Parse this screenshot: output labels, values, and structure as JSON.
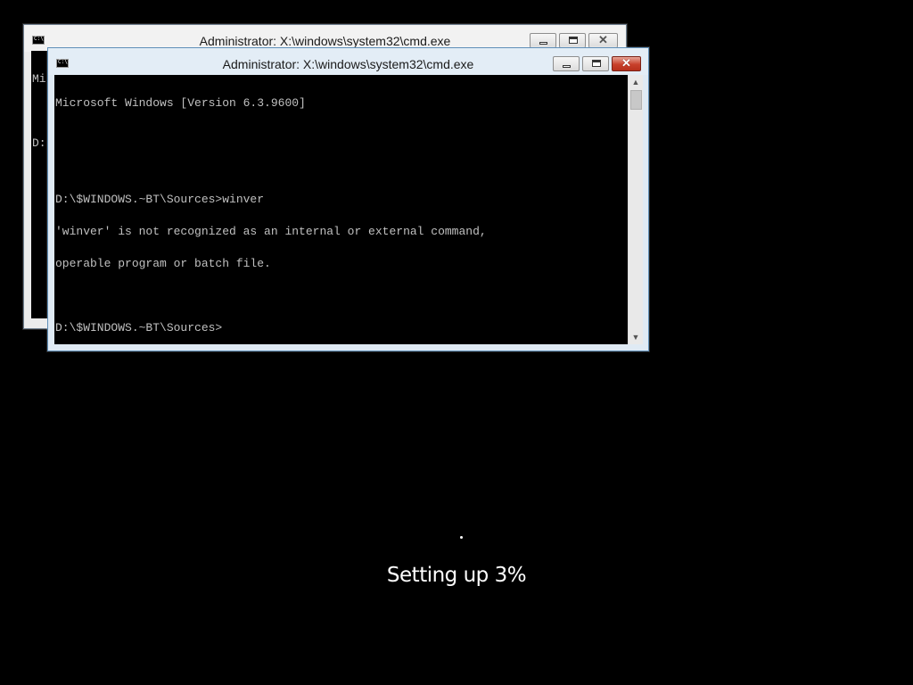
{
  "back_window": {
    "title": "Administrator: X:\\windows\\system32\\cmd.exe",
    "console_lines": [
      "Mi",
      "",
      "D:"
    ],
    "close_label": "✕"
  },
  "front_window": {
    "title": "Administrator: X:\\windows\\system32\\cmd.exe",
    "console_lines": [
      "Microsoft Windows [Version 6.3.9600]",
      "",
      "",
      "D:\\$WINDOWS.~BT\\Sources>winver",
      "'winver' is not recognized as an internal or external command,",
      "operable program or batch file.",
      "",
      "D:\\$WINDOWS.~BT\\Sources>"
    ],
    "close_label": "✕",
    "scroll_up": "▲",
    "scroll_down": "▼"
  },
  "setup": {
    "status_text": "Setting up 3%",
    "progress_percent": 3
  },
  "colors": {
    "desktop_background": "#000000",
    "console_background": "#000000",
    "console_text": "#c0c0c0",
    "close_button": "#c8402b",
    "status_text": "#ffffff"
  },
  "icons": {
    "window_icon": "cmd-icon",
    "minimize": "minimize-icon",
    "maximize": "maximize-icon",
    "close": "close-icon"
  }
}
